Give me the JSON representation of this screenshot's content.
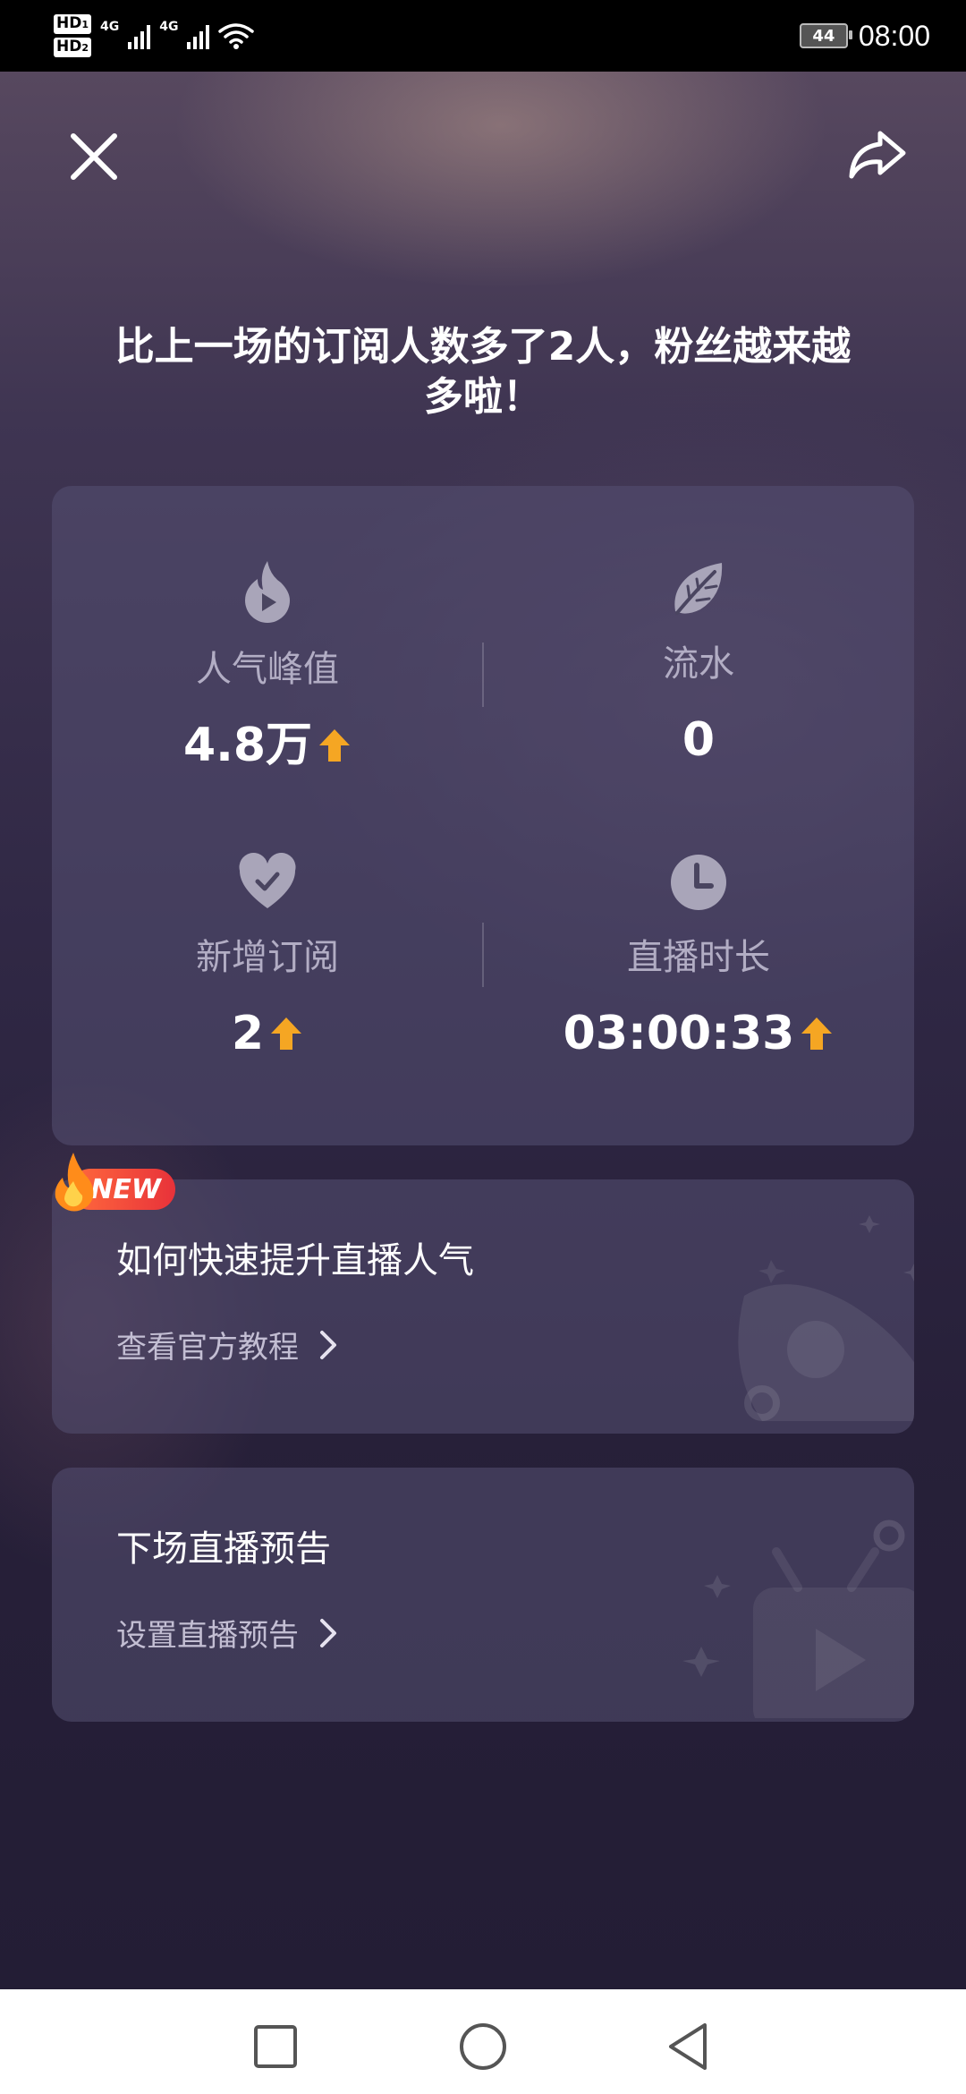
{
  "status_bar": {
    "sim1": "HD",
    "sim1_slot": "1",
    "sim2": "HD",
    "sim2_slot": "2",
    "net1": "4G",
    "net2": "4G",
    "battery": "44",
    "time": "08:00"
  },
  "header": {
    "close_icon": "close-icon",
    "share_icon": "share-icon"
  },
  "headline": "比上一场的订阅人数多了2人，粉丝越来越多啦！",
  "stats": {
    "peak_popularity": {
      "label": "人气峰值",
      "value": "4.8万",
      "trend": "up",
      "icon": "flame-icon"
    },
    "revenue": {
      "label": "流水",
      "value": "0",
      "icon": "leaf-icon"
    },
    "new_subscriptions": {
      "label": "新增订阅",
      "value": "2",
      "trend": "up",
      "icon": "heart-check-icon"
    },
    "live_duration": {
      "label": "直播时长",
      "value": "03:00:33",
      "trend": "up",
      "icon": "clock-icon"
    }
  },
  "tutorial_card": {
    "badge": "NEW",
    "title": "如何快速提升直播人气",
    "link": "查看官方教程"
  },
  "preview_card": {
    "title": "下场直播预告",
    "link": "设置直播预告"
  },
  "colors": {
    "accent_arrow": "#f5a623",
    "badge_start": "#ff6a3d",
    "badge_end": "#e8323a",
    "background": "#262038"
  },
  "nav_bar": {
    "recent": "square-icon",
    "home": "circle-icon",
    "back": "triangle-back-icon"
  }
}
